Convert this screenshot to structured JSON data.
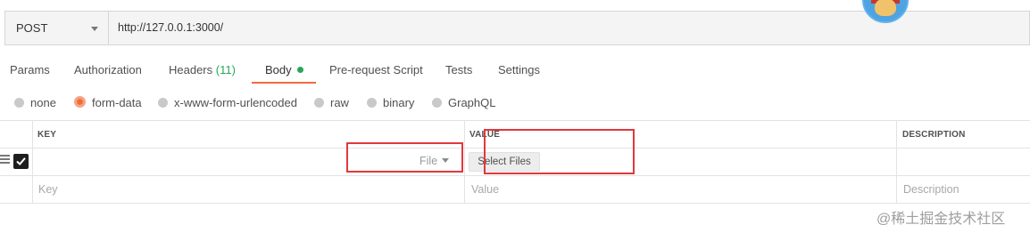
{
  "request": {
    "method": "POST",
    "url": "http://127.0.0.1:3000/"
  },
  "tabs": [
    {
      "label": "Params"
    },
    {
      "label": "Authorization"
    },
    {
      "label": "Headers",
      "count": "(11)"
    },
    {
      "label": "Body",
      "active": true
    },
    {
      "label": "Pre-request Script"
    },
    {
      "label": "Tests"
    },
    {
      "label": "Settings"
    }
  ],
  "body_types": [
    {
      "label": "none"
    },
    {
      "label": "form-data",
      "selected": true
    },
    {
      "label": "x-www-form-urlencoded"
    },
    {
      "label": "raw"
    },
    {
      "label": "binary"
    },
    {
      "label": "GraphQL"
    }
  ],
  "table": {
    "headers": {
      "key": "KEY",
      "value": "VALUE",
      "description": "DESCRIPTION"
    },
    "row": {
      "checked": true,
      "key_type": "File",
      "value_button": "Select Files"
    },
    "placeholders": {
      "key": "Key",
      "value": "Value",
      "description": "Description"
    }
  },
  "watermark": "@稀土掘金技术社区",
  "colors": {
    "accent": "#f26b3a",
    "active_dot": "#26a65b",
    "highlight_box": "#e0383e"
  }
}
